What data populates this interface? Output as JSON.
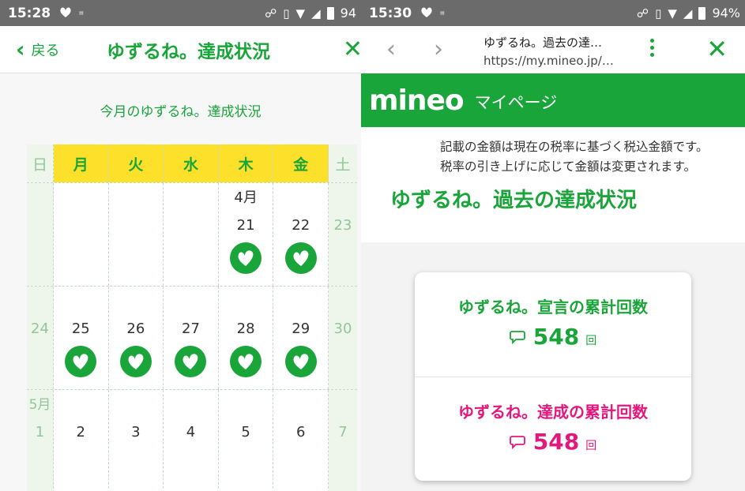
{
  "status_left": {
    "time": "15:28",
    "battery": "94"
  },
  "status_right": {
    "time": "15:30",
    "battery": "94%"
  },
  "left": {
    "header": {
      "back_label": "戻る",
      "title": "ゆずるね。達成状況",
      "close": "✕"
    },
    "month_status": "今月のゆずるね。達成状況",
    "weekdays": [
      "日",
      "月",
      "火",
      "水",
      "木",
      "金",
      "土"
    ],
    "rows": [
      {
        "cells": [
          {
            "day": "",
            "mon": "",
            "badge": false
          },
          {
            "day": "",
            "mon": "",
            "badge": false
          },
          {
            "day": "",
            "mon": "",
            "badge": false
          },
          {
            "day": "",
            "mon": "",
            "badge": false
          },
          {
            "day": "21",
            "mon": "4月",
            "badge": true
          },
          {
            "day": "22",
            "mon": "",
            "badge": true
          },
          {
            "day": "23",
            "mon": "",
            "badge": false
          }
        ]
      },
      {
        "cells": [
          {
            "day": "24",
            "mon": "",
            "badge": false
          },
          {
            "day": "25",
            "mon": "",
            "badge": true
          },
          {
            "day": "26",
            "mon": "",
            "badge": true
          },
          {
            "day": "27",
            "mon": "",
            "badge": true
          },
          {
            "day": "28",
            "mon": "",
            "badge": true
          },
          {
            "day": "29",
            "mon": "",
            "badge": true
          },
          {
            "day": "30",
            "mon": "",
            "badge": false
          }
        ]
      },
      {
        "cells": [
          {
            "day": "1",
            "mon": "5月",
            "badge": false
          },
          {
            "day": "2",
            "mon": "",
            "badge": false
          },
          {
            "day": "3",
            "mon": "",
            "badge": false
          },
          {
            "day": "4",
            "mon": "",
            "badge": false
          },
          {
            "day": "5",
            "mon": "",
            "badge": false
          },
          {
            "day": "6",
            "mon": "",
            "badge": false
          },
          {
            "day": "7",
            "mon": "",
            "badge": false
          }
        ]
      }
    ]
  },
  "right": {
    "toolbar": {
      "page_title": "ゆずるね。過去の達…",
      "url": "https://my.mineo.jp/…",
      "back": "‹",
      "forward": "›",
      "close": "✕"
    },
    "brand": {
      "logo": "mineo",
      "page": "マイページ"
    },
    "notice": {
      "line1": "記載の金額は現在の税率に基づく税込金額です。",
      "line2": "税率の引き上げに応じて金額は変更されます。"
    },
    "past_title": "ゆずるね。過去の達成状況",
    "stats": [
      {
        "label": "ゆずるね。宣言の累計回数",
        "value": "548",
        "unit": "回",
        "color": "#1aa53a"
      },
      {
        "label": "ゆずるね。達成の累計回数",
        "value": "548",
        "unit": "回",
        "color": "#e4177c"
      }
    ]
  },
  "colors": {
    "accent": "#1aa53a",
    "pink": "#e4177c",
    "weekday_header": "#fde02a"
  }
}
